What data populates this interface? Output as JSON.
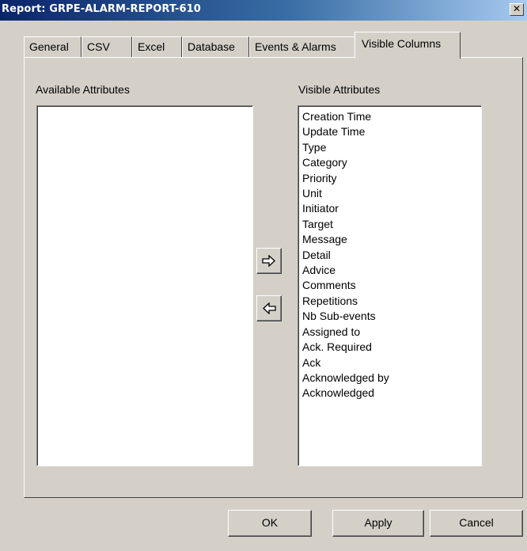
{
  "window": {
    "title": "Report: GRPE-ALARM-REPORT-610",
    "close_glyph": "✕"
  },
  "tabs": [
    {
      "label": "General",
      "active": false
    },
    {
      "label": "CSV",
      "active": false
    },
    {
      "label": "Excel",
      "active": false
    },
    {
      "label": "Database",
      "active": false
    },
    {
      "label": "Events & Alarms",
      "active": false
    },
    {
      "label": "Visible Columns",
      "active": true
    }
  ],
  "available": {
    "label": "Available Attributes",
    "items": []
  },
  "visible": {
    "label": "Visible Attributes",
    "items": [
      "Creation Time",
      "Update Time",
      "Type",
      "Category",
      "Priority",
      "Unit",
      "Initiator",
      "Target",
      "Message",
      "Detail",
      "Advice",
      "Comments",
      "Repetitions",
      "Nb Sub-events",
      "Assigned to",
      "Ack. Required",
      "Ack",
      "Acknowledged by",
      "Acknowledged"
    ]
  },
  "arrows": {
    "move_right_icon": "arrow-right-icon",
    "move_left_icon": "arrow-left-icon"
  },
  "buttons": {
    "ok": "OK",
    "apply": "Apply",
    "cancel": "Cancel"
  },
  "colors": {
    "face": "#d4d0c8",
    "title_start": "#0a246a",
    "title_end": "#a6caf0"
  }
}
